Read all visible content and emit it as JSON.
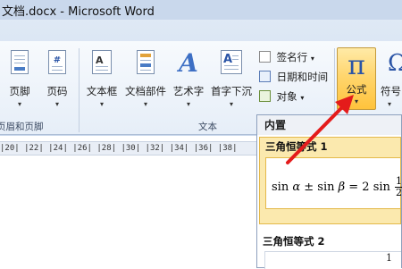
{
  "window": {
    "title": "文档.docx - Microsoft Word"
  },
  "ribbon": {
    "buttons": {
      "footer": "页脚",
      "page_number": "页码",
      "textbox": "文本框",
      "quick_parts": "文档部件",
      "wordart": "艺术字",
      "dropcap": "首字下沉",
      "equation": "公式",
      "symbol": "符号"
    },
    "small_buttons": {
      "signature_line": "签名行",
      "date_time": "日期和时间",
      "object": "对象"
    },
    "groups": {
      "header_footer": "页眉和页脚",
      "text": "文本"
    },
    "dropdown_arrow": "▾"
  },
  "ruler": {
    "text": "|20|  |22|  |24|  |26|  |28|  |30|  |32|  |34|  |36|  |38|"
  },
  "equation_gallery": {
    "section_header": "内置",
    "entries": [
      {
        "title": "三角恒等式 1"
      },
      {
        "title": "三角恒等式 2"
      }
    ]
  },
  "colors": {
    "highlight": "#ffd66e",
    "arrow": "#e41b1b",
    "icon_blue": "#2a54a6"
  }
}
